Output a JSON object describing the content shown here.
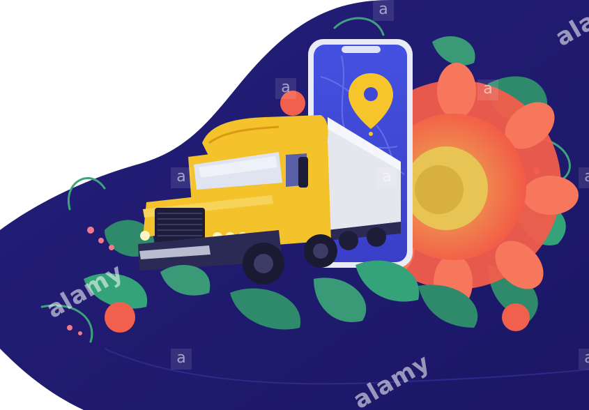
{
  "illustration": {
    "subject": "truck-and-phone-with-location-pin",
    "colors": {
      "background": "#1f1b6e",
      "truck_body": "#f4c22b",
      "truck_shadow": "#d99a14",
      "trailer": "#e6e7ee",
      "phone_screen": "#3f49d8",
      "pin": "#f6c52c",
      "flower_outer": "#f25d4b",
      "flower_center": "#e6c34a",
      "leaf": "#2f8a6b"
    }
  },
  "watermarks": {
    "brand": "alamy",
    "logo_letter": "a"
  }
}
